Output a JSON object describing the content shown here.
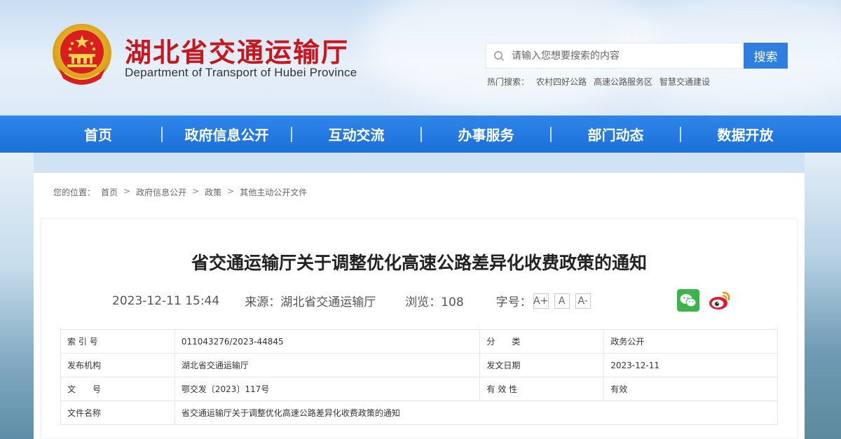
{
  "header": {
    "title": "湖北省交通运输厅",
    "subtitle": "Department of Transport of Hubei Province",
    "search": {
      "placeholder": "请输入您想要搜索的内容",
      "button": "搜索"
    },
    "hot_search": {
      "label": "热门搜索：",
      "items": [
        "农村四好公路",
        "高速公路服务区",
        "智慧交通建设"
      ]
    }
  },
  "nav": {
    "items": [
      "首页",
      "政府信息公开",
      "互动交流",
      "办事服务",
      "部门动态",
      "数据开放"
    ]
  },
  "breadcrumb": {
    "label": "您的位置：",
    "items": [
      "首页",
      "政府信息公开",
      "政策",
      "其他主动公开文件"
    ],
    "separator": ">"
  },
  "article": {
    "title": "省交通运输厅关于调整优化高速公路差异化收费政策的通知",
    "date": "2023-12-11 15:44",
    "source": "来源：湖北省交通运输厅",
    "views": "浏览：108",
    "font_label": "字号：",
    "font_sizes": [
      "A+",
      "A",
      "A-"
    ]
  },
  "info": {
    "rows": [
      {
        "l1": "索 引 号",
        "v1": "011043276/2023-44845",
        "l2": "分　　类",
        "v2": "政务公开"
      },
      {
        "l1": "发布机构",
        "v1": "湖北省交通运输厅",
        "l2": "发文日期",
        "v2": "2023-12-11"
      },
      {
        "l1": "文　　号",
        "v1": "鄂交发〔2023〕117号",
        "l2": "有 效 性",
        "v2": "有效"
      },
      {
        "l1": "文件名称",
        "v1": "省交通运输厅关于调整优化高速公路差异化收费政策的通知"
      }
    ]
  },
  "colors": {
    "brand_red": "#c8161d",
    "nav_blue": "#1b6fd8",
    "search_blue": "#2f7fe0"
  }
}
